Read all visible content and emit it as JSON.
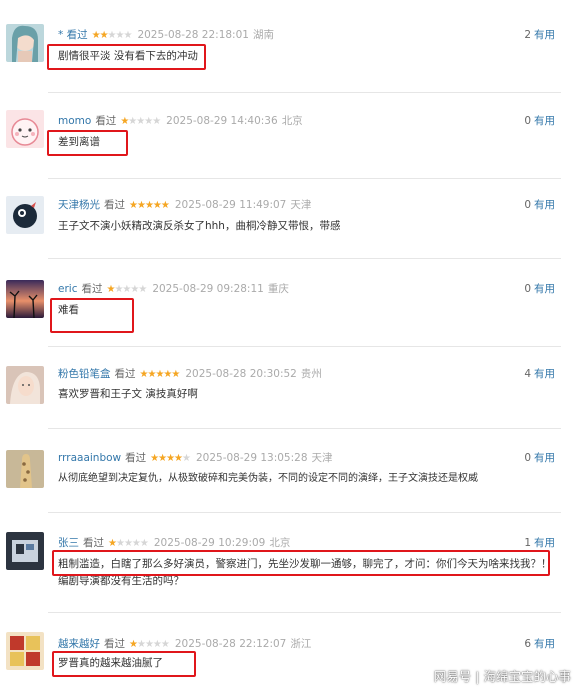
{
  "comments": [
    {
      "user": "* 看过",
      "stars": 2,
      "time": "2025-08-28 22:18:01",
      "location": "湖南",
      "votes": "2",
      "votes_label": "有用",
      "text": "剧情很平淡 没有看下去的冲动",
      "colors": {
        "avatar_bg": "#bcd7dc",
        "avatar_fg": "#6aa0a8"
      }
    },
    {
      "user": "momo",
      "stars": 1,
      "time": "2025-08-29 14:40:36",
      "location": "北京",
      "votes": "0",
      "votes_label": "有用",
      "text": "差到离谱",
      "colors": {
        "avatar_bg": "#fbe4e6",
        "avatar_fg": "#e88a96"
      }
    },
    {
      "user": "天津杨光",
      "stars": 5,
      "time": "2025-08-29 11:49:07",
      "location": "天津",
      "votes": "0",
      "votes_label": "有用",
      "text": "王子文不演小妖精改演反杀女了hhh，曲桐冷静又带恨，带感",
      "colors": {
        "avatar_bg": "#e6ecf2",
        "avatar_fg": "#1c2a3a"
      }
    },
    {
      "user": "eric",
      "stars": 1,
      "time": "2025-08-29 09:28:11",
      "location": "重庆",
      "votes": "0",
      "votes_label": "有用",
      "text": "难看",
      "colors": {
        "avatar_bg": "#5a3a6b",
        "avatar_fg": "#e8906a"
      }
    },
    {
      "user": "粉色铅笔盒",
      "stars": 5,
      "time": "2025-08-28 20:30:52",
      "location": "贵州",
      "votes": "4",
      "votes_label": "有用",
      "text": "喜欢罗晋和王子文 演技真好啊",
      "colors": {
        "avatar_bg": "#d9c4b8",
        "avatar_fg": "#f2e4da"
      }
    },
    {
      "user": "rrraaainbow",
      "stars": 4,
      "time": "2025-08-29 13:05:28",
      "location": "天津",
      "votes": "0",
      "votes_label": "有用",
      "text": "从彻底绝望到决定复仇，从极致破碎和完美伪装，不同的设定不同的演绎，王子文演技还是权威",
      "colors": {
        "avatar_bg": "#c8b898",
        "avatar_fg": "#8a6a40"
      }
    },
    {
      "user": "张三",
      "stars": 1,
      "time": "2025-08-29 10:29:09",
      "location": "北京",
      "votes": "1",
      "votes_label": "有用",
      "text": "粗制滥造，白瞎了那么多好演员，警察进门，先坐沙发聊一通够，聊完了，才问：你们今天为啥来找我？！",
      "text2": "编剧导演都没有生活的吗？",
      "colors": {
        "avatar_bg": "#2c3440",
        "avatar_fg": "#c9d2de"
      }
    },
    {
      "user": "越来越好",
      "stars": 1,
      "time": "2025-08-28 22:12:07",
      "location": "浙江",
      "votes": "6",
      "votes_label": "有用",
      "text": "罗晋真的越来越油腻了",
      "colors": {
        "avatar_bg": "#f3e2c4",
        "avatar_fg": "#c0392b"
      }
    }
  ],
  "watched_label": "看过",
  "star_glyph": "★",
  "highlight_color": "#e0161b",
  "watermark": {
    "brand": "网易号",
    "separator": "|",
    "author": "海绵宝宝的心事"
  }
}
